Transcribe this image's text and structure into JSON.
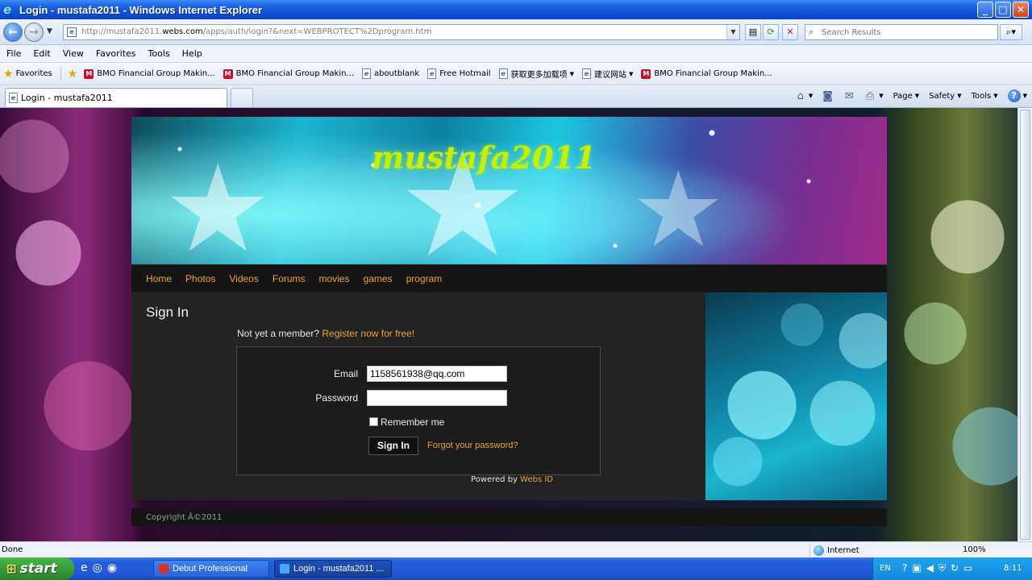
{
  "window": {
    "title": "Login - mustafa2011 - Windows Internet Explorer",
    "minimize_glyph": "_",
    "maximize_glyph": "□",
    "close_glyph": "✕"
  },
  "address_bar": {
    "url_prefix": "http://mustafa2011.",
    "url_host": "webs.com",
    "url_suffix": "/apps/auth/login?&next=WEBPROTECT%2Dprogram.htm"
  },
  "search": {
    "placeholder": "Search Results"
  },
  "menu": [
    "File",
    "Edit",
    "View",
    "Favorites",
    "Tools",
    "Help"
  ],
  "favorites_bar": {
    "favorites_label": "Favorites",
    "links": [
      "BMO Financial Group  Makin...",
      "BMO Financial Group  Makin...",
      "aboutblank",
      "Free Hotmail",
      "获取更多加载项",
      "建议网站",
      "BMO Financial Group  Makin..."
    ]
  },
  "tab": {
    "label": "Login - mustafa2011"
  },
  "command_bar": {
    "page": "Page",
    "safety": "Safety",
    "tools": "Tools"
  },
  "site": {
    "title": "mustafa2011",
    "nav": [
      "Home",
      "Photos",
      "Videos",
      "Forums",
      "movies",
      "games",
      "program"
    ],
    "signin": {
      "heading": "Sign In",
      "not_member": "Not yet a member?",
      "register_link": "Register now for free!",
      "email_label": "Email",
      "email_value": "1158561938@qq.com",
      "password_label": "Password",
      "password_value": "",
      "remember_label": "Remember me",
      "remember_checked": false,
      "submit_label": "Sign In",
      "forgot_link": "Forgot your password?"
    },
    "powered_by": "Powered by",
    "powered_brand": "Webs ID",
    "copyright": "Copyright Â©2011"
  },
  "status_bar": {
    "status": "Done",
    "zone": "Internet",
    "zoom": "100%"
  },
  "taskbar": {
    "start_label": "start",
    "apps": [
      "Debut Professional",
      "Login - mustafa2011 ..."
    ],
    "language": "EN",
    "clock": "8:11"
  },
  "colors": {
    "accent": "#f0a030",
    "site_title": "#c6f000",
    "page_dark": "#232323"
  }
}
